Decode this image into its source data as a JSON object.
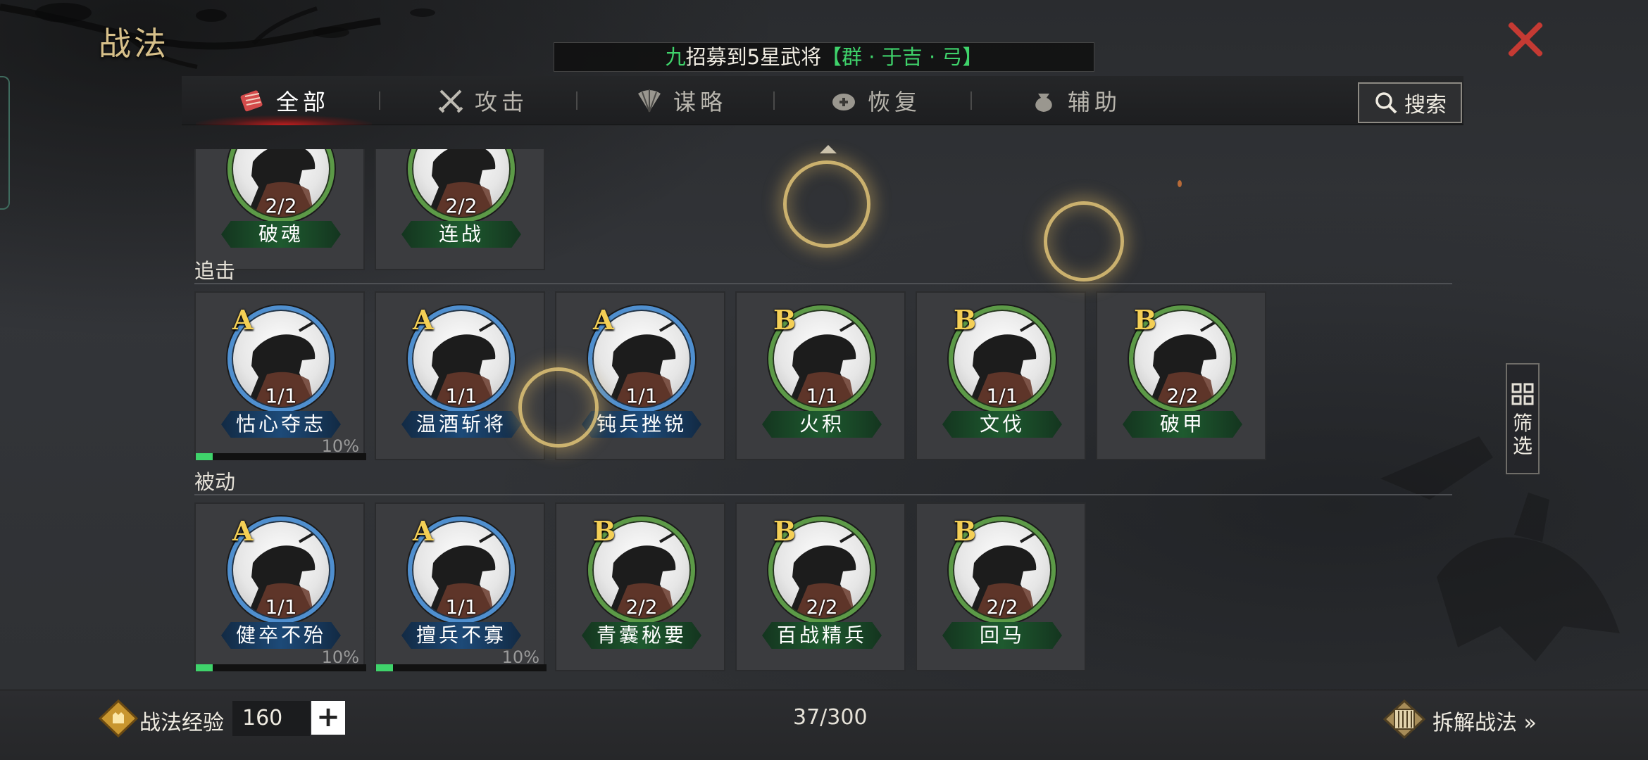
{
  "header": {
    "title": "战法",
    "broadcast": {
      "prefix": "九",
      "middle": "招募到5星武将",
      "highlight": "【群 · 于吉 · 弓】"
    }
  },
  "tabs": [
    {
      "label": "全部",
      "icon": "all-tactics-icon",
      "active": true
    },
    {
      "label": "攻击",
      "icon": "crossed-swords-icon",
      "active": false
    },
    {
      "label": "谋略",
      "icon": "strategy-fan-icon",
      "active": false
    },
    {
      "label": "恢复",
      "icon": "recovery-icon",
      "active": false
    },
    {
      "label": "辅助",
      "icon": "support-bag-icon",
      "active": false
    }
  ],
  "search": {
    "label": "搜索"
  },
  "filter": {
    "label": "筛选"
  },
  "sections": [
    {
      "label": "",
      "cards": [
        {
          "grade": "",
          "count": "2/2",
          "name": "破魂",
          "color": "B"
        },
        {
          "grade": "",
          "count": "2/2",
          "name": "连战",
          "color": "B"
        }
      ]
    },
    {
      "label": "追击",
      "cards": [
        {
          "grade": "A",
          "count": "1/1",
          "name": "怙心夺志",
          "progress": "10%"
        },
        {
          "grade": "A",
          "count": "1/1",
          "name": "温酒斩将"
        },
        {
          "grade": "A",
          "count": "1/1",
          "name": "钝兵挫锐"
        },
        {
          "grade": "B",
          "count": "1/1",
          "name": "火积"
        },
        {
          "grade": "B",
          "count": "1/1",
          "name": "文伐"
        },
        {
          "grade": "B",
          "count": "2/2",
          "name": "破甲"
        }
      ]
    },
    {
      "label": "被动",
      "cards": [
        {
          "grade": "A",
          "count": "1/1",
          "name": "健卒不殆",
          "progress": "10%"
        },
        {
          "grade": "A",
          "count": "1/1",
          "name": "擅兵不寡",
          "progress": "10%"
        },
        {
          "grade": "B",
          "count": "2/2",
          "name": "青囊秘要"
        },
        {
          "grade": "B",
          "count": "2/2",
          "name": "百战精兵"
        },
        {
          "grade": "B",
          "count": "2/2",
          "name": "回马"
        }
      ]
    }
  ],
  "footer": {
    "exp_label": "战法经验",
    "exp_value": "160",
    "plus_label": "+",
    "capacity": "37/300",
    "dismantle_label": "拆解战法 »"
  },
  "colors": {
    "gold": "#d7c08a",
    "grade_a_ring": "#4f8fcf",
    "grade_b_ring": "#5c9a47",
    "highlight_green": "#3fd36b",
    "close_red": "#c53a33"
  }
}
